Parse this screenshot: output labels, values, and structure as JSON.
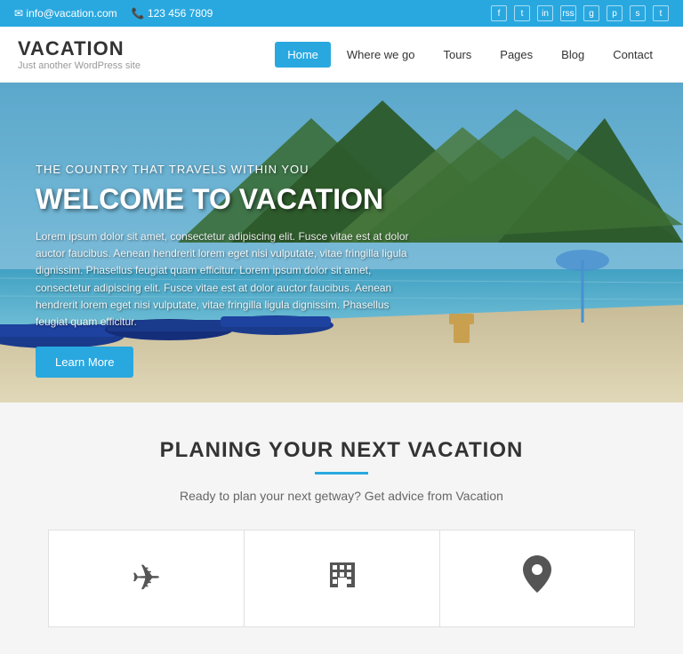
{
  "topbar": {
    "email": "info@vacation.com",
    "phone": "123 456 7809",
    "email_icon": "✉",
    "phone_icon": "📞",
    "social_icons": [
      "f",
      "t",
      "in",
      "rss",
      "g+",
      "p",
      "s",
      "t2"
    ]
  },
  "header": {
    "logo_title": "VACATION",
    "logo_sub": "Just another WordPress site",
    "nav_items": [
      {
        "label": "Home",
        "active": true
      },
      {
        "label": "Where we go",
        "active": false
      },
      {
        "label": "Tours",
        "active": false
      },
      {
        "label": "Pages",
        "active": false
      },
      {
        "label": "Blog",
        "active": false
      },
      {
        "label": "Contact",
        "active": false
      }
    ]
  },
  "hero": {
    "tagline": "THE COUNTRY THAT TRAVELS WITHIN YOU",
    "title": "WELCOME TO VACATION",
    "body": "Lorem ipsum dolor sit amet, consectetur adipiscing elit. Fusce vitae est at dolor auctor faucibus. Aenean hendrerit lorem eget nisi vulputate, vitae fringilla ligula dignissim. Phasellus feugiat quam efficitur. Lorem ipsum dolor sit amet, consectetur adipiscing elit. Fusce vitae est at dolor auctor faucibus. Aenean hendrerit lorem eget nisi vulputate, vitae fringilla ligula dignissim. Phasellus feugiat quam efficitur.",
    "btn_label": "Learn More"
  },
  "planning": {
    "title": "PLANING YOUR NEXT VACATION",
    "subtitle": "Ready to plan your next getway? Get advice from Vacation",
    "cards": [
      {
        "icon": "✈",
        "label": "flights"
      },
      {
        "icon": "▦",
        "label": "hotels"
      },
      {
        "icon": "📍",
        "label": "locations"
      }
    ]
  }
}
